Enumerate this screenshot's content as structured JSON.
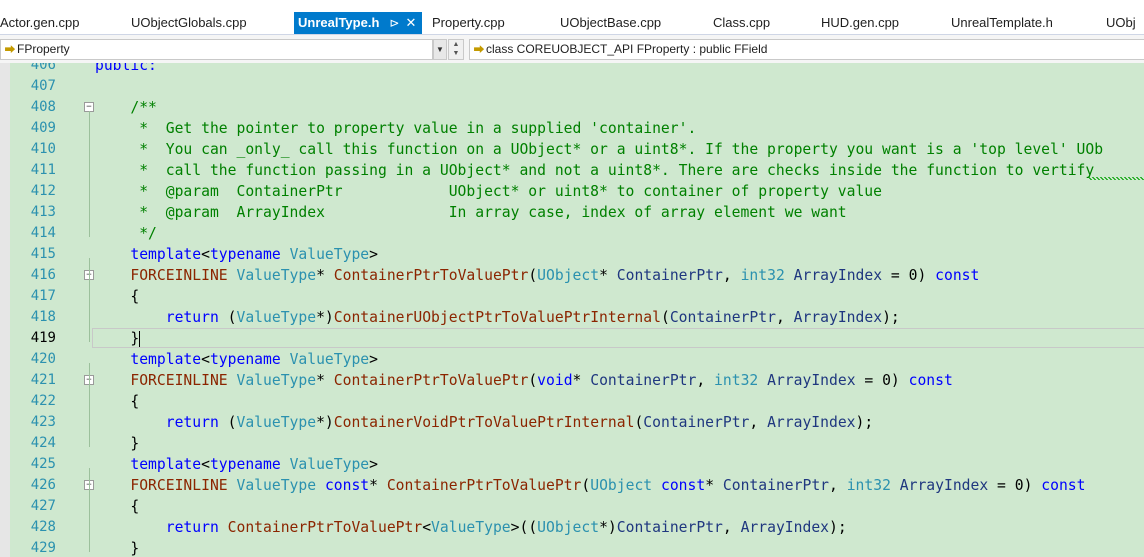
{
  "tabs": [
    {
      "label": "Actor.gen.cpp",
      "active": false
    },
    {
      "label": "UObjectGlobals.cpp",
      "active": false
    },
    {
      "label": "UnrealType.h",
      "active": true,
      "pin": "⊳",
      "close": "✕"
    },
    {
      "label": "Property.cpp",
      "active": false
    },
    {
      "label": "UObjectBase.cpp",
      "active": false
    },
    {
      "label": "Class.cpp",
      "active": false
    },
    {
      "label": "HUD.gen.cpp",
      "active": false
    },
    {
      "label": "UnrealTemplate.h",
      "active": false
    },
    {
      "label": "UObj",
      "active": false
    }
  ],
  "nav": {
    "scope": "FProperty",
    "member": "class COREUOBJECT_API FProperty : public FField"
  },
  "editor": {
    "current_line": "419",
    "lines": [
      {
        "n": "406",
        "code": [
          [
            "kw",
            "public:"
          ]
        ]
      },
      {
        "n": "407",
        "code": []
      },
      {
        "n": "408",
        "code": [
          [
            "cm",
            "    /**"
          ]
        ]
      },
      {
        "n": "409",
        "code": [
          [
            "cm",
            "     *  Get the pointer to property value in a supplied 'container'."
          ]
        ]
      },
      {
        "n": "410",
        "code": [
          [
            "cm",
            "     *  You can _only_ call this function on a UObject* or a uint8*. If the property you want is a 'top level' UOb"
          ]
        ]
      },
      {
        "n": "411",
        "code": [
          [
            "cm",
            "     *  call the function passing in a UObject* and not a uint8*. There are checks inside the function to vertify"
          ]
        ]
      },
      {
        "n": "412",
        "code": [
          [
            "cm",
            "     *  @param  ContainerPtr            UObject* or uint8* to container of property value"
          ]
        ]
      },
      {
        "n": "413",
        "code": [
          [
            "cm",
            "     *  @param  ArrayIndex              In array case, index of array element we want"
          ]
        ]
      },
      {
        "n": "414",
        "code": [
          [
            "cm",
            "     */"
          ]
        ]
      },
      {
        "n": "415",
        "code": [
          [
            "op",
            "    "
          ],
          [
            "kw",
            "template"
          ],
          [
            "op",
            "<"
          ],
          [
            "kw",
            "typename"
          ],
          [
            "op",
            " "
          ],
          [
            "ty",
            "ValueType"
          ],
          [
            "op",
            ">"
          ]
        ]
      },
      {
        "n": "416",
        "code": [
          [
            "op",
            "    "
          ],
          [
            "mac",
            "FORCEINLINE"
          ],
          [
            "op",
            " "
          ],
          [
            "ty",
            "ValueType"
          ],
          [
            "op",
            "* "
          ],
          [
            "fn",
            "ContainerPtrToValuePtr"
          ],
          [
            "op",
            "("
          ],
          [
            "ty",
            "UObject"
          ],
          [
            "op",
            "* "
          ],
          [
            "pm",
            "ContainerPtr"
          ],
          [
            "op",
            ", "
          ],
          [
            "ty",
            "int32"
          ],
          [
            "op",
            " "
          ],
          [
            "pm",
            "ArrayIndex"
          ],
          [
            "op",
            " = 0) "
          ],
          [
            "kw",
            "const"
          ]
        ]
      },
      {
        "n": "417",
        "code": [
          [
            "op",
            "    {"
          ]
        ]
      },
      {
        "n": "418",
        "code": [
          [
            "op",
            "        "
          ],
          [
            "kw",
            "return"
          ],
          [
            "op",
            " ("
          ],
          [
            "ty",
            "ValueType"
          ],
          [
            "op",
            "*)"
          ],
          [
            "fn",
            "ContainerUObjectPtrToValuePtrInternal"
          ],
          [
            "op",
            "("
          ],
          [
            "pm",
            "ContainerPtr"
          ],
          [
            "op",
            ", "
          ],
          [
            "pm",
            "ArrayIndex"
          ],
          [
            "op",
            ");"
          ]
        ]
      },
      {
        "n": "419",
        "code": [
          [
            "op",
            "    }"
          ]
        ]
      },
      {
        "n": "420",
        "code": [
          [
            "op",
            "    "
          ],
          [
            "kw",
            "template"
          ],
          [
            "op",
            "<"
          ],
          [
            "kw",
            "typename"
          ],
          [
            "op",
            " "
          ],
          [
            "ty",
            "ValueType"
          ],
          [
            "op",
            ">"
          ]
        ]
      },
      {
        "n": "421",
        "code": [
          [
            "op",
            "    "
          ],
          [
            "mac",
            "FORCEINLINE"
          ],
          [
            "op",
            " "
          ],
          [
            "ty",
            "ValueType"
          ],
          [
            "op",
            "* "
          ],
          [
            "fn",
            "ContainerPtrToValuePtr"
          ],
          [
            "op",
            "("
          ],
          [
            "kw",
            "void"
          ],
          [
            "op",
            "* "
          ],
          [
            "pm",
            "ContainerPtr"
          ],
          [
            "op",
            ", "
          ],
          [
            "ty",
            "int32"
          ],
          [
            "op",
            " "
          ],
          [
            "pm",
            "ArrayIndex"
          ],
          [
            "op",
            " = 0) "
          ],
          [
            "kw",
            "const"
          ]
        ]
      },
      {
        "n": "422",
        "code": [
          [
            "op",
            "    {"
          ]
        ]
      },
      {
        "n": "423",
        "code": [
          [
            "op",
            "        "
          ],
          [
            "kw",
            "return"
          ],
          [
            "op",
            " ("
          ],
          [
            "ty",
            "ValueType"
          ],
          [
            "op",
            "*)"
          ],
          [
            "fn",
            "ContainerVoidPtrToValuePtrInternal"
          ],
          [
            "op",
            "("
          ],
          [
            "pm",
            "ContainerPtr"
          ],
          [
            "op",
            ", "
          ],
          [
            "pm",
            "ArrayIndex"
          ],
          [
            "op",
            ");"
          ]
        ]
      },
      {
        "n": "424",
        "code": [
          [
            "op",
            "    }"
          ]
        ]
      },
      {
        "n": "425",
        "code": [
          [
            "op",
            "    "
          ],
          [
            "kw",
            "template"
          ],
          [
            "op",
            "<"
          ],
          [
            "kw",
            "typename"
          ],
          [
            "op",
            " "
          ],
          [
            "ty",
            "ValueType"
          ],
          [
            "op",
            ">"
          ]
        ]
      },
      {
        "n": "426",
        "code": [
          [
            "op",
            "    "
          ],
          [
            "mac",
            "FORCEINLINE"
          ],
          [
            "op",
            " "
          ],
          [
            "ty",
            "ValueType"
          ],
          [
            "op",
            " "
          ],
          [
            "kw",
            "const"
          ],
          [
            "op",
            "* "
          ],
          [
            "fn",
            "ContainerPtrToValuePtr"
          ],
          [
            "op",
            "("
          ],
          [
            "ty",
            "UObject"
          ],
          [
            "op",
            " "
          ],
          [
            "kw",
            "const"
          ],
          [
            "op",
            "* "
          ],
          [
            "pm",
            "ContainerPtr"
          ],
          [
            "op",
            ", "
          ],
          [
            "ty",
            "int32"
          ],
          [
            "op",
            " "
          ],
          [
            "pm",
            "ArrayIndex"
          ],
          [
            "op",
            " = 0) "
          ],
          [
            "kw",
            "const"
          ]
        ]
      },
      {
        "n": "427",
        "code": [
          [
            "op",
            "    {"
          ]
        ]
      },
      {
        "n": "428",
        "code": [
          [
            "op",
            "        "
          ],
          [
            "kw",
            "return"
          ],
          [
            "op",
            " "
          ],
          [
            "fn",
            "ContainerPtrToValuePtr"
          ],
          [
            "op",
            "<"
          ],
          [
            "ty",
            "ValueType"
          ],
          [
            "op",
            ">(("
          ],
          [
            "ty",
            "UObject"
          ],
          [
            "op",
            "*)"
          ],
          [
            "pm",
            "ContainerPtr"
          ],
          [
            "op",
            ", "
          ],
          [
            "pm",
            "ArrayIndex"
          ],
          [
            "op",
            ");"
          ]
        ]
      },
      {
        "n": "429",
        "code": [
          [
            "op",
            "    }"
          ]
        ]
      }
    ]
  }
}
